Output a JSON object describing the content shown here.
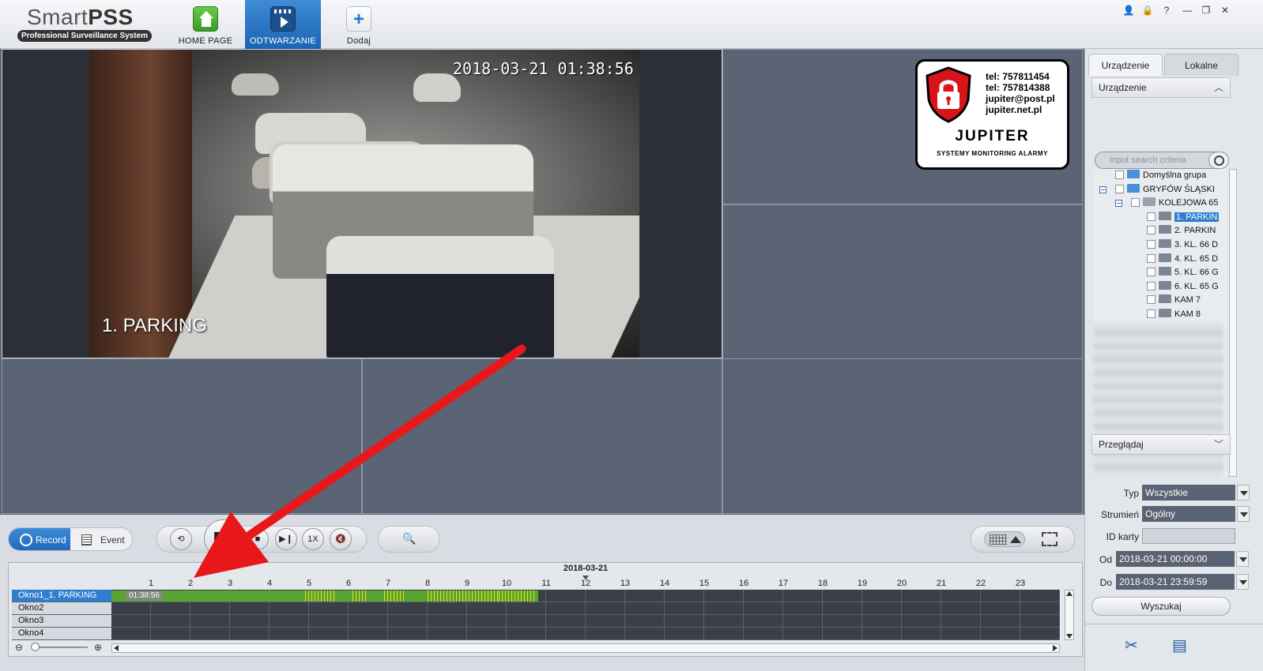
{
  "app": {
    "logo_title_light": "Smart",
    "logo_title_bold": "PSS",
    "logo_subtitle": "Professional Surveillance System"
  },
  "nav": [
    {
      "label": "HOME PAGE",
      "icon": "home-icon"
    },
    {
      "label": "ODTWARZANIE",
      "icon": "playback-icon"
    },
    {
      "label": "Dodaj",
      "icon": "add-icon"
    }
  ],
  "window_controls": [
    "user-icon",
    "lock-icon",
    "help-icon",
    "minimize-icon",
    "restore-icon",
    "close-icon"
  ],
  "window_control_glyphs": [
    "👤",
    "🔒",
    "?",
    "—",
    "❐",
    "✕"
  ],
  "video": {
    "timestamp": "2018-03-21  01:38:56",
    "camera_label": "1. PARKING"
  },
  "overlay_logo": {
    "lines": [
      "tel: 757811454",
      "tel: 757814388",
      "jupiter@post.pl",
      "jupiter.net.pl"
    ],
    "name": "JUPITER",
    "tagline": "SYSTEMY MONITORING ALARMY"
  },
  "controls": {
    "record_label": "Record",
    "event_label": "Event",
    "speed_label": "1X"
  },
  "timeline": {
    "date": "2018-03-21",
    "hours": [
      "1",
      "2",
      "3",
      "4",
      "5",
      "6",
      "7",
      "8",
      "9",
      "10",
      "11",
      "12",
      "13",
      "14",
      "15",
      "16",
      "17",
      "18",
      "19",
      "20",
      "21",
      "22",
      "23"
    ],
    "rows": [
      {
        "name": "Okno1_1. PARKING",
        "selected": true
      },
      {
        "name": "Okno2",
        "selected": false
      },
      {
        "name": "Okno3",
        "selected": false
      },
      {
        "name": "Okno4",
        "selected": false
      }
    ],
    "cursor_time": "01:38:56",
    "record_start_hour": 0,
    "record_end_hour": 10.8
  },
  "right_panel": {
    "tabs": [
      "Urządzenie",
      "Lokalne"
    ],
    "device_section": "Urządzenie",
    "search_placeholder": "Input search criteria",
    "tree": [
      {
        "label": "Domyślna grupa",
        "level": 1,
        "type": "folder"
      },
      {
        "label": "GRYFÓW ŚLĄSKI",
        "level": 1,
        "type": "folder",
        "expanded": true
      },
      {
        "label": "KOLEJOWA 65",
        "level": 2,
        "type": "device",
        "expanded": true
      },
      {
        "label": "1. PARKIN",
        "level": 3,
        "type": "camera",
        "selected": true
      },
      {
        "label": "2. PARKIN",
        "level": 3,
        "type": "camera"
      },
      {
        "label": "3. KL. 66 D",
        "level": 3,
        "type": "camera"
      },
      {
        "label": "4. KL. 65 D",
        "level": 3,
        "type": "camera"
      },
      {
        "label": "5. KL. 66 G",
        "level": 3,
        "type": "camera"
      },
      {
        "label": "6. KL. 65 G",
        "level": 3,
        "type": "camera"
      },
      {
        "label": "KAM 7",
        "level": 3,
        "type": "camera"
      },
      {
        "label": "KAM 8",
        "level": 3,
        "type": "camera"
      }
    ],
    "browse_section": "Przeglądaj",
    "filters": {
      "type_label": "Typ",
      "type_value": "Wszystkie",
      "stream_label": "Strumień",
      "stream_value": "Ogólny",
      "card_label": "ID karty",
      "card_value": "",
      "from_label": "Od",
      "from_value": "2018-03-21 00:00:00",
      "to_label": "Do",
      "to_value": "2018-03-21 23:59:59"
    },
    "search_button": "Wyszukaj"
  },
  "colors": {
    "accent": "#1f68b8",
    "record_green": "#5aa330",
    "event_yellow": "#e8e21c",
    "arrow_red": "#e8181a"
  }
}
